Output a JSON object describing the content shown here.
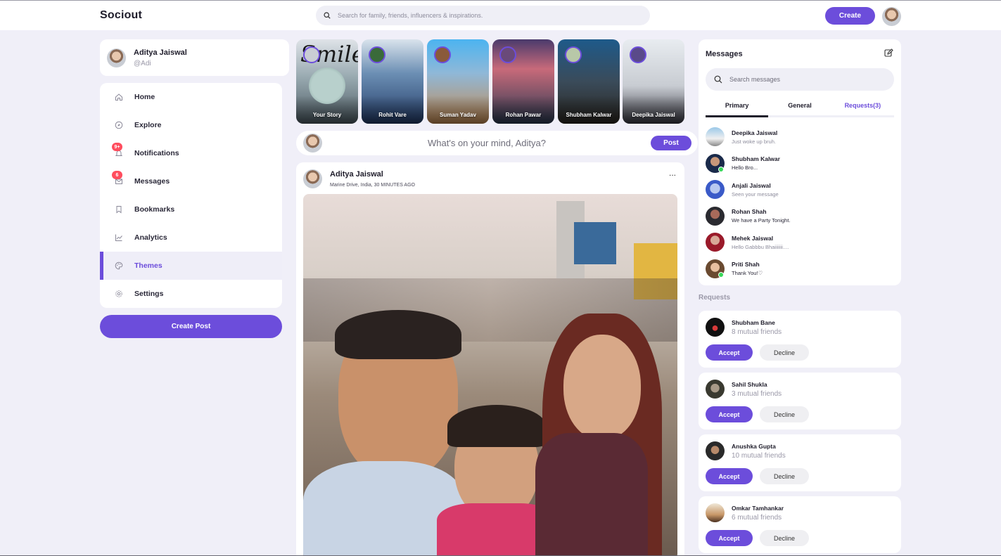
{
  "app": {
    "logo": "Sociout"
  },
  "nav": {
    "search_placeholder": "Search for family, friends, influencers & inspirations.",
    "create_label": "Create"
  },
  "profile": {
    "name": "Aditya Jaiswal",
    "handle": "@Adi"
  },
  "sidebar": {
    "items": [
      {
        "label": "Home",
        "icon": "home-icon"
      },
      {
        "label": "Explore",
        "icon": "compass-icon"
      },
      {
        "label": "Notifications",
        "icon": "bell-icon",
        "badge": "9+"
      },
      {
        "label": "Messages",
        "icon": "mail-icon",
        "badge": "6"
      },
      {
        "label": "Bookmarks",
        "icon": "bookmark-icon"
      },
      {
        "label": "Analytics",
        "icon": "chart-line-icon"
      },
      {
        "label": "Themes",
        "icon": "palette-icon",
        "active": true
      },
      {
        "label": "Settings",
        "icon": "gear-icon"
      }
    ],
    "create_post_label": "Create Post"
  },
  "stories": [
    {
      "name": "Your Story"
    },
    {
      "name": "Rohit Vare"
    },
    {
      "name": "Suman Yadav"
    },
    {
      "name": "Rohan Pawar"
    },
    {
      "name": "Shubham Kalwar"
    },
    {
      "name": "Deepika Jaiswal"
    }
  ],
  "story_overlay_text": "Smile",
  "composer": {
    "placeholder": "What's on your mind, Aditya?",
    "post_label": "Post"
  },
  "feed": {
    "post": {
      "author": "Aditya Jaiswal",
      "meta": "Marine Drive, India, 30 MINUTES AGO",
      "more": "..."
    }
  },
  "messages": {
    "title": "Messages",
    "search_placeholder": "Search messages",
    "tabs": [
      "Primary",
      "General",
      "Requests(3)"
    ],
    "items": [
      {
        "name": "Deepika Jaiswal",
        "preview": "Just woke up bruh.",
        "online": false,
        "unread": false
      },
      {
        "name": "Shubham Kalwar",
        "preview": "Hello Bro...",
        "online": true,
        "unread": true
      },
      {
        "name": "Anjali Jaiswal",
        "preview": "Seen your message",
        "online": false,
        "unread": false
      },
      {
        "name": "Rohan Shah",
        "preview": "We have a Party Tonight.",
        "online": false,
        "unread": true
      },
      {
        "name": "Mehek Jaiswal",
        "preview": "Hello Gabbbu Bhaiiiiiii....",
        "online": false,
        "unread": false
      },
      {
        "name": "Priti Shah",
        "preview": "Thank You!♡",
        "online": true,
        "unread": true
      }
    ]
  },
  "requests": {
    "label": "Requests",
    "accept_label": "Accept",
    "decline_label": "Decline",
    "items": [
      {
        "name": "Shubham Bane",
        "mutual": "8 mutual friends"
      },
      {
        "name": "Sahil Shukla",
        "mutual": "3 mutual friends"
      },
      {
        "name": "Anushka Gupta",
        "mutual": "10 mutual friends"
      },
      {
        "name": "Omkar Tamhankar",
        "mutual": "6 mutual friends"
      }
    ]
  },
  "colors": {
    "accent": "#6c4ddb",
    "background": "#f0eff8",
    "badge": "#ff4d5e",
    "online": "#38d85a"
  }
}
